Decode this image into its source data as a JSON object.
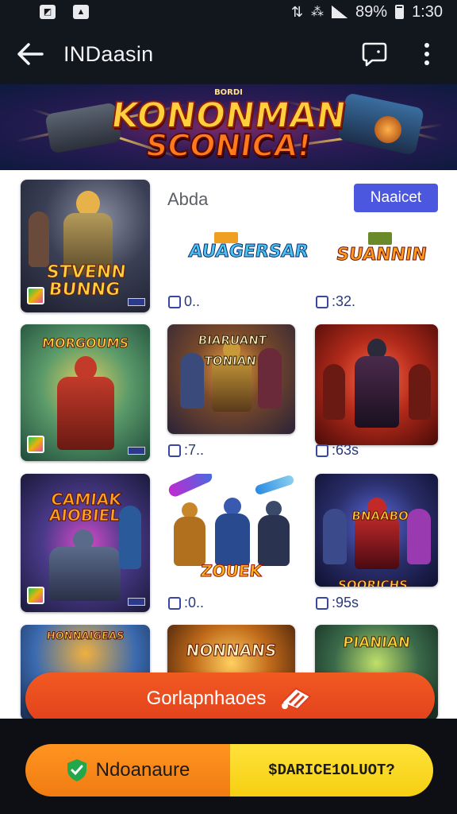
{
  "status_bar": {
    "battery": "89%",
    "time": "1:30"
  },
  "app_bar": {
    "title": "INDaasin"
  },
  "banner": {
    "sub": "BORDI",
    "line1": "KONONMAN",
    "line2": "SCONICA!"
  },
  "section": {
    "label": "Abda",
    "filter_chip": "Naaicet"
  },
  "tiles": {
    "t1": {
      "logo": "STVENN BUNNG"
    },
    "t2": {
      "logo": "AUAGERSAR"
    },
    "t3": {
      "logo": "SUANNIN"
    },
    "t4": {
      "logo": "MORGOUMS"
    },
    "t5": {
      "logo": "BIARUANT TONIAN"
    },
    "t7": {
      "logo": "CAMIAK AIOBIEL"
    },
    "t8": {
      "logo": "ZOUEK"
    },
    "t9": {
      "logo": "BNAABO SOORICHS"
    },
    "t10": {
      "logo": "HONNAIGEAS"
    },
    "t11": {
      "logo": "NONNANS"
    },
    "t12": {
      "logo": "PIANIAN"
    }
  },
  "meta": {
    "m2": "0..",
    "m3": ":32.",
    "m5": ":7..",
    "m6": ":63s",
    "m8": ":0..",
    "m9": ":95s"
  },
  "primary_button": {
    "label": "Gorlapnhaoes"
  },
  "bottom": {
    "left_label": "Ndoanaure",
    "right_label": "$DARICE1OLUOT?"
  },
  "colors": {
    "accent": "#4c57e0",
    "cta": "#e2401c",
    "orange": "#f07c12",
    "yellow": "#f5cf12"
  }
}
